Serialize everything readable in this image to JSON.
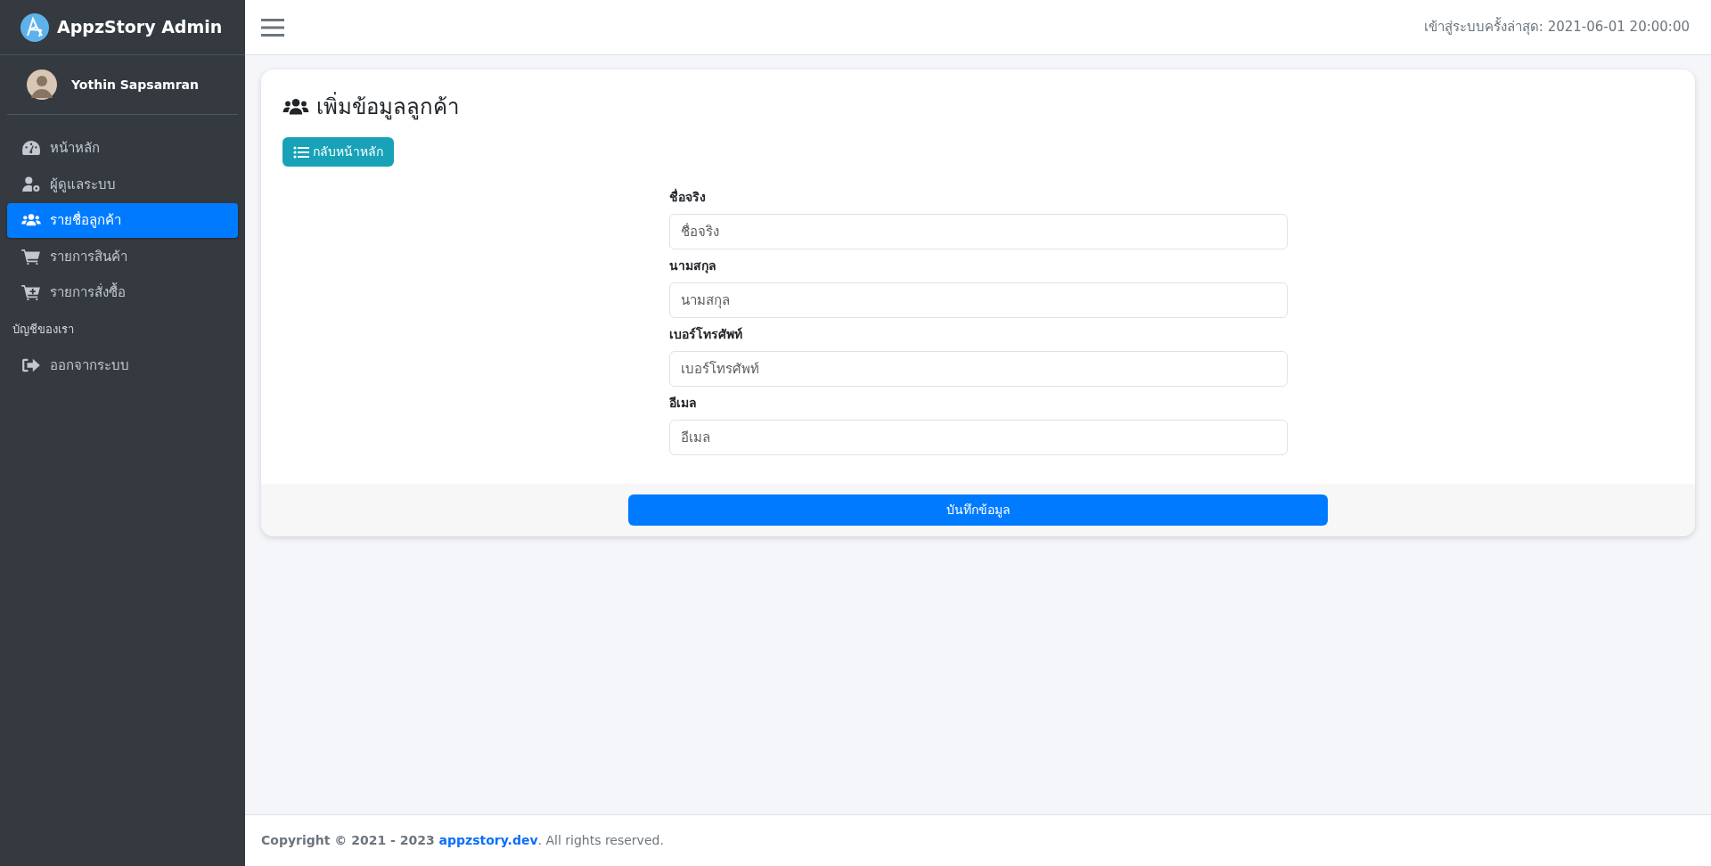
{
  "brand": {
    "title": "AppzStory Admin"
  },
  "user": {
    "name": "Yothin Sapsamran"
  },
  "sidebar": {
    "items": [
      {
        "label": "หน้าหลัก",
        "selected": false
      },
      {
        "label": "ผู้ดูแลระบบ",
        "selected": false
      },
      {
        "label": "รายชื่อลูกค้า",
        "selected": true
      },
      {
        "label": "รายการสินค้า",
        "selected": false
      },
      {
        "label": "รายการสั่งซื้อ",
        "selected": false
      }
    ],
    "section_header": "บัญชีของเรา",
    "account_items": [
      {
        "label": "ออกจากระบบ",
        "selected": false
      }
    ]
  },
  "topbar": {
    "last_login": "เข้าสู่ระบบครั้งล่าสุด: 2021-06-01 20:00:00"
  },
  "card": {
    "title": "เพิ่มข้อมูลลูกค้า",
    "back_button": "กลับหน้าหลัก",
    "fields": [
      {
        "label": "ชื่อจริง",
        "placeholder": "ชื่อจริง"
      },
      {
        "label": "นามสกุล",
        "placeholder": "นามสกุล"
      },
      {
        "label": "เบอร์โทรศัพท์",
        "placeholder": "เบอร์โทรศัพท์"
      },
      {
        "label": "อีเมล",
        "placeholder": "อีเมล"
      }
    ],
    "submit_button": "บันทึกข้อมูล"
  },
  "footer": {
    "prefix": "Copyright © 2021 - 2023",
    "link": "appzstory.dev",
    "suffix": ". All rights reserved."
  }
}
